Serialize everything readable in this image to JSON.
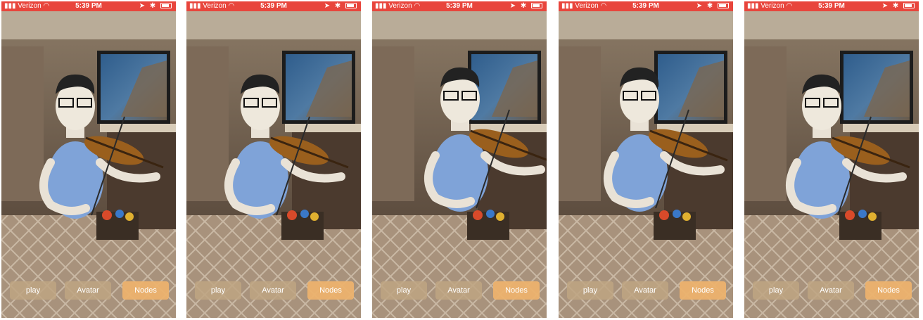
{
  "status_bar": {
    "carrier": "Verizon",
    "time": "5:39 PM"
  },
  "buttons": {
    "play": "play",
    "avatar": "Avatar",
    "nodes": "Nodes"
  },
  "colors": {
    "status_bar": "#e8453c",
    "button": "#bea582",
    "nodes_button": "#ecb26e"
  },
  "icons": [
    "wifi-icon",
    "signal-icon",
    "location-icon",
    "bluetooth-icon",
    "battery-icon"
  ],
  "panels": [
    {
      "id": "frame-1",
      "pose": "bow-low"
    },
    {
      "id": "frame-2",
      "pose": "bow-mid"
    },
    {
      "id": "frame-3",
      "pose": "bow-up-right"
    },
    {
      "id": "frame-4",
      "pose": "hand-raised"
    },
    {
      "id": "frame-5",
      "pose": "bow-up"
    }
  ]
}
